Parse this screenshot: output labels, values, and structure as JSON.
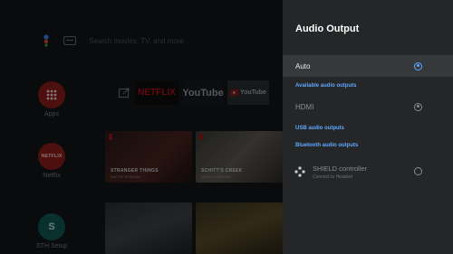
{
  "home": {
    "search_placeholder": "Search movies, TV, and more",
    "apps": [
      {
        "label": "Apps",
        "color": "#c62828"
      },
      {
        "label": "Netflix",
        "color": "#c62828",
        "logo": "NETFLIX"
      },
      {
        "label": "STH Setup",
        "color": "#00897b",
        "logo": "S"
      }
    ],
    "favorites": [
      {
        "name": "netflix",
        "text": "NETFLIX",
        "color": "#e50914",
        "bg": "#0e0e0e"
      },
      {
        "name": "youtube",
        "text": "YouTube",
        "color": "#ffffff",
        "bg": "#151a1f"
      },
      {
        "name": "youtube-tv",
        "text": "YouTube",
        "color": "#ffffff",
        "bg": "#2a2c2e"
      }
    ]
  },
  "panel": {
    "title": "Audio Output",
    "options": [
      {
        "label": "Auto",
        "selected": true
      }
    ],
    "sections": {
      "available": "Available audio outputs",
      "usb": "USB audio outputs",
      "bluetooth": "Bluetooth audio outputs"
    },
    "hdmi": {
      "label": "HDMI"
    },
    "controller": {
      "title": "SHIELD controller",
      "subtitle": "Connect to Headset"
    }
  },
  "colors": {
    "accent": "#5fa8ff",
    "panel": "#242628",
    "selected_row": "#36393c"
  }
}
